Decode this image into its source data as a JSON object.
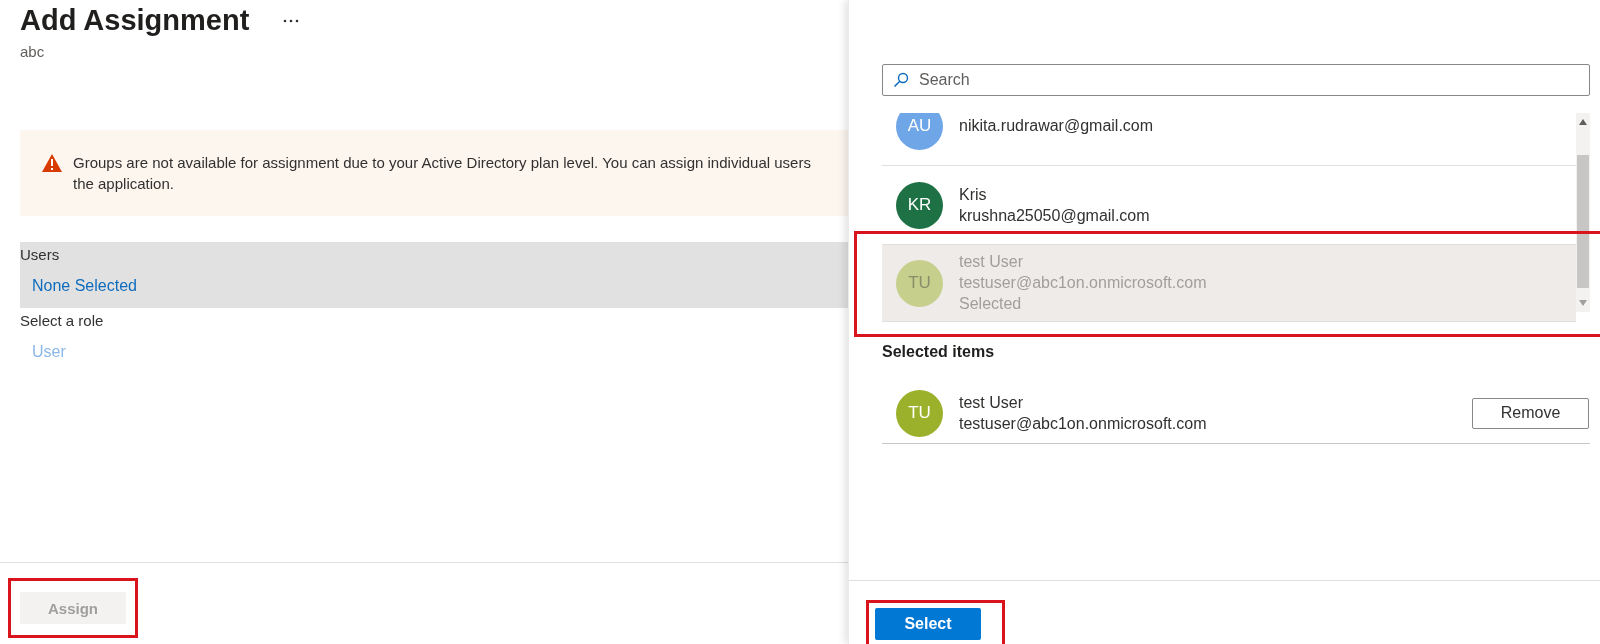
{
  "page": {
    "title": "Add Assignment",
    "subtitle": "abc"
  },
  "warning": {
    "lines": [
      "Groups are not available for assignment due to your Active Directory plan level. You can assign individual users",
      "the application."
    ]
  },
  "users_field": {
    "label": "Users",
    "value": "None Selected"
  },
  "role_field": {
    "label": "Select a role",
    "value": "User"
  },
  "assign_button": {
    "label": "Assign",
    "disabled": true,
    "highlighted": true
  },
  "picker": {
    "search": {
      "placeholder": "Search"
    },
    "users": [
      {
        "initials": "AU",
        "email": "nikita.rudrawar@gmail.com",
        "color": "#6fa6e8",
        "selected": false,
        "highlighted": false
      },
      {
        "initials": "KR",
        "name": "Kris",
        "email": "krushna25050@gmail.com",
        "color": "#1e7145",
        "selected": false,
        "highlighted": false
      },
      {
        "initials": "TU",
        "name": "test User",
        "email": "testuser@abc1on.onmicrosoft.com",
        "status": "Selected",
        "color": "#c6d08c",
        "selected": true,
        "highlighted": true
      }
    ],
    "selected_heading": "Selected items",
    "selected_items": [
      {
        "initials": "TU",
        "name": "test User",
        "email": "testuser@abc1on.onmicrosoft.com",
        "color": "#9bb12b",
        "action": "Remove"
      }
    ],
    "select_button": {
      "label": "Select",
      "highlighted": true
    }
  }
}
